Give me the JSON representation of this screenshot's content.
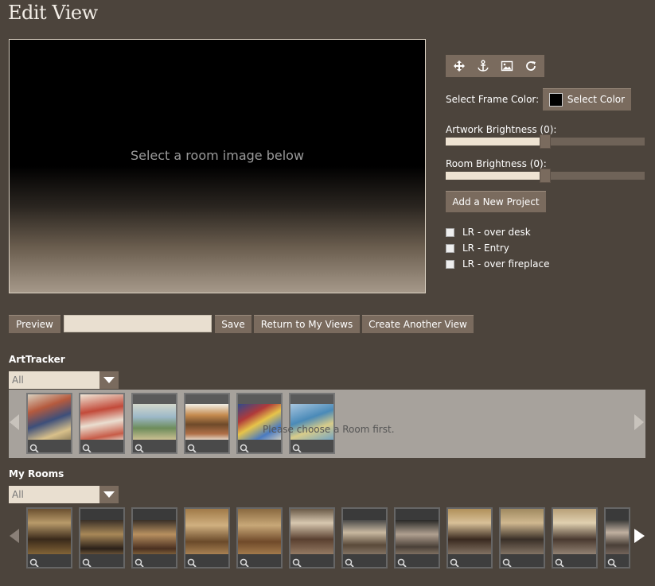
{
  "header": {
    "title": "Edit View"
  },
  "canvas": {
    "placeholder": "Select a room image below"
  },
  "toolbar": {
    "icons": [
      "move-icon",
      "anchor-icon",
      "image-icon",
      "refresh-icon"
    ]
  },
  "frame": {
    "label": "Select Frame Color:",
    "button": "Select Color",
    "color": "#000000"
  },
  "artwork_brightness": {
    "label": "Artwork Brightness (0):",
    "level": 0.5
  },
  "room_brightness": {
    "label": "Room Brightness (0):",
    "level": 0.5
  },
  "add_project": "Add a New Project",
  "projects": [
    "LR - over desk",
    "LR - Entry",
    "LR - over fireplace"
  ],
  "actions": {
    "preview": "Preview",
    "view_name_value": "",
    "save": "Save",
    "return": "Return to My Views",
    "create": "Create Another View"
  },
  "arttracker": {
    "label": "ArtTracker",
    "filter": "All",
    "message": "Please choose a Room first.",
    "thumb_count": 6
  },
  "rooms": {
    "label": "My Rooms",
    "filter": "All",
    "thumb_count": 12
  },
  "colors": {
    "background": "#4c443c",
    "button": "#7a6b5e",
    "input": "#e9dfd0"
  }
}
